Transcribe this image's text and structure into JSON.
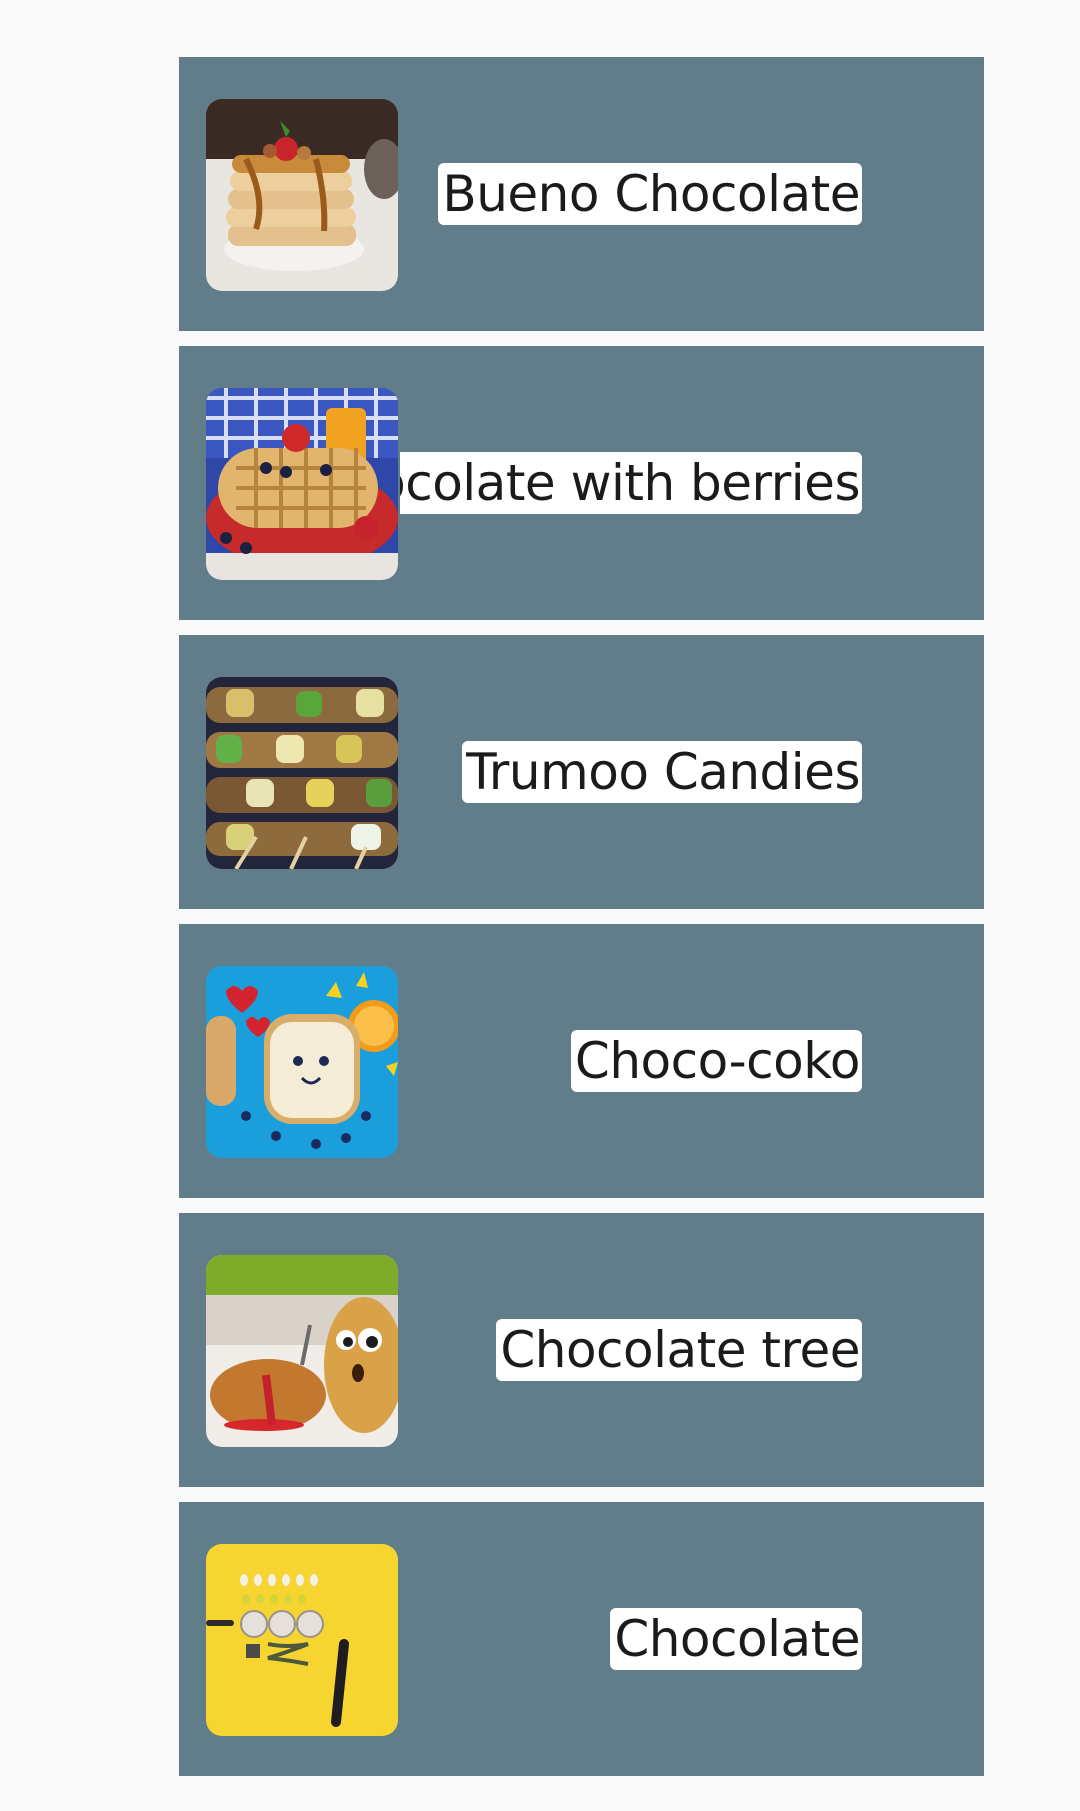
{
  "items": [
    {
      "title": "Bueno Chocolate",
      "image_icon": "pancakes-image",
      "image_color": "#d9b68a"
    },
    {
      "title": "Chocolate with berries",
      "image_icon": "waffles-image",
      "image_color": "#c23b2c"
    },
    {
      "title": "Trumoo Candies",
      "image_icon": "skewers-image",
      "image_color": "#3a3a2a"
    },
    {
      "title": "Choco-coko",
      "image_icon": "toast-face-image",
      "image_color": "#1ea3dd"
    },
    {
      "title": "Chocolate tree",
      "image_icon": "potatoes-image",
      "image_color": "#b5863a"
    },
    {
      "title": "Chocolate",
      "image_icon": "yellow-table-image",
      "image_color": "#f6d32d"
    }
  ],
  "colors": {
    "background": "#f9f9f9",
    "card": "#627d8a",
    "label_bg": "#ffffff",
    "label_text": "#1b1b1b"
  }
}
